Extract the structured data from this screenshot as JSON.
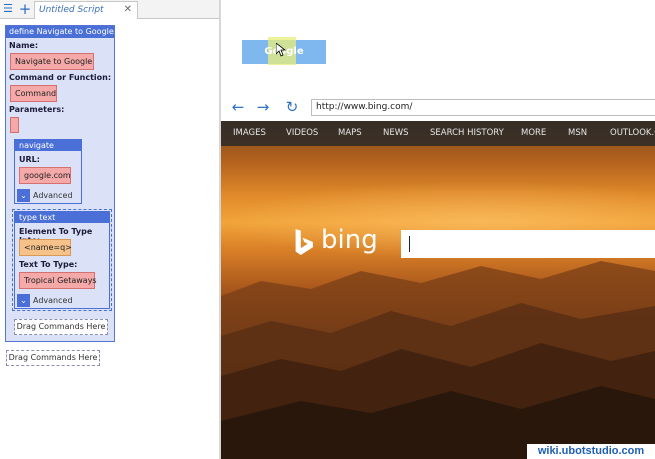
{
  "tabbar": {
    "menu_icon": "hamburger-icon",
    "add_icon": "plus-icon",
    "tab_title": "Untitled Script",
    "close_glyph": "✕"
  },
  "define_block": {
    "header": "define Navigate to Google",
    "name_label": "Name:",
    "name_value": "Navigate to Google",
    "command_label": "Command or Function:",
    "command_value": "Command",
    "params_label": "Parameters:",
    "params_value": ""
  },
  "navigate_block": {
    "header": "navigate",
    "url_label": "URL:",
    "url_value": "google.com",
    "advanced_label": "Advanced"
  },
  "type_text_block": {
    "header": "type text",
    "element_label": "Element To Type Into:",
    "element_value": "<name=q>",
    "text_label": "Text To Type:",
    "text_value": "Tropical Getaways",
    "advanced_label": "Advanced"
  },
  "drag_inner": "Drag Commands Here",
  "drag_outer": "Drag Commands Here",
  "ui_button": {
    "label": "Google"
  },
  "browser": {
    "back_icon": "arrow-left-icon",
    "forward_icon": "arrow-right-icon",
    "refresh_icon": "refresh-icon",
    "url": "http://www.bing.com/"
  },
  "bing": {
    "nav": [
      "IMAGES",
      "VIDEOS",
      "MAPS",
      "NEWS",
      "SEARCH HISTORY",
      "MORE",
      "MSN",
      "OUTLOOK.COM"
    ],
    "logo_text": "bing",
    "search_value": ""
  },
  "watermark": "wiki.ubotstudio.com",
  "colors": {
    "accent": "#4a6fd6",
    "field_red": "#f5a9a9",
    "field_orange": "#f6c28a",
    "button_blue": "#7fb8ee"
  }
}
